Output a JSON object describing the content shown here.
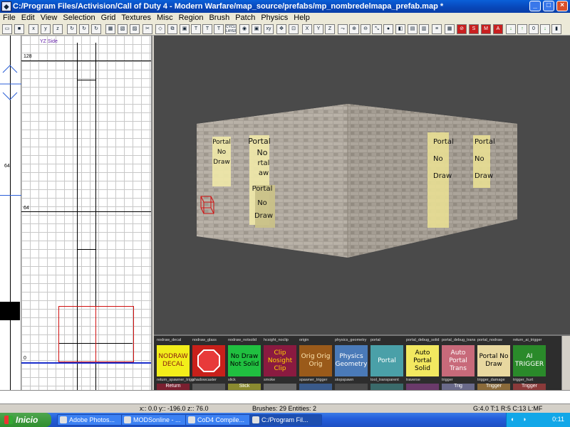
{
  "window": {
    "title": "C:/Program Files/Activision/Call of Duty 4 - Modern Warfare/map_source/prefabs/mp_nombredelmapa_prefab.map *",
    "minimize": "_",
    "maximize": "□",
    "close": "×"
  },
  "menu": [
    "File",
    "Edit",
    "View",
    "Selection",
    "Grid",
    "Textures",
    "Misc",
    "Region",
    "Brush",
    "Patch",
    "Physics",
    "Help"
  ],
  "toolbar": {
    "cycle_layer": "CYCLE LAYER",
    "red_badge_labels": [
      "S",
      "M",
      "A"
    ],
    "number_zero": "0"
  },
  "ruler": {
    "labels": [
      "64"
    ]
  },
  "grid_view": {
    "view_name": "YZ Side",
    "labels": [
      "128",
      "64",
      "0"
    ]
  },
  "viewport_3d": {
    "decal_words": [
      "Portal",
      "No",
      "Draw"
    ],
    "decal_fragment_words": [
      "rtal",
      "No",
      "aw",
      "Draw"
    ]
  },
  "textures": [
    {
      "name": "nodraw_decal",
      "label": "NODRAW DECAL",
      "bg": "#f2ee1a",
      "fg": "#8a1a10"
    },
    {
      "name": "nodraw_glass",
      "label": "",
      "bg": "#c8201a",
      "fg": "#ffffff"
    },
    {
      "name": "nodraw_notsolid",
      "label": "No Draw Not Solid",
      "bg": "#20c040",
      "fg": "#000000"
    },
    {
      "name": "hcsight_noclip",
      "label": "Clip Nosight Clip",
      "bg": "#8a1a40",
      "fg": "#ffd200"
    },
    {
      "name": "origin",
      "label": "Orig Orig Orig",
      "bg": "#9a5a1a",
      "fg": "#ffe6b0"
    },
    {
      "name": "physics_geometry",
      "label": "Physics Geometry",
      "bg": "#4a7ab8",
      "fg": "#ffffff"
    },
    {
      "name": "portal",
      "label": "Portal",
      "bg": "#4aa0a8",
      "fg": "#ffffff"
    },
    {
      "name": "portal_debug_solid",
      "label": "Auto Portal Solid",
      "bg": "#f2e860",
      "fg": "#000000"
    },
    {
      "name": "portal_debug_trans",
      "label": "Auto Portal Trans",
      "bg": "#c86a7a",
      "fg": "#ffffff"
    },
    {
      "name": "portal_nodraw",
      "label": "Portal No Draw",
      "bg": "#e8d8a0",
      "fg": "#000000"
    },
    {
      "name": "return_ai_trigger",
      "label": "AI TRIGGER",
      "bg": "#2a8a2a",
      "fg": "#ffffff"
    }
  ],
  "textures_row2": [
    "return_spawner_trigger",
    "shadowcaster",
    "slick",
    "smoke",
    "spawner_trigger",
    "stopspawn",
    "tool_transparent",
    "traverse",
    "trigger",
    "trigger_damage",
    "trigger_hurt"
  ],
  "textures_row3_labels": [
    "Return",
    "",
    "Slick",
    "",
    "",
    "",
    "",
    "",
    "Trig",
    "Trigger",
    "Trigger"
  ],
  "status": {
    "coords": "x:: 0.0  y:: -196.0  z:: 76.0",
    "brushes": "Brushes: 29  Entities: 2",
    "grid": "G:4.0  T:1  R:5  C:13  L:MF"
  },
  "taskbar": {
    "start": "Inicio",
    "tasks": [
      "Adobe Photos...",
      "MODSonline - ...",
      "CoD4 Compile...",
      "C:/Program Fil..."
    ],
    "clock": "0:11"
  },
  "colors": {
    "titlebar": "#0a5fd8",
    "taskbar": "#245edb",
    "start": "#3a9a3a",
    "viewport": "#4a4a4a"
  }
}
